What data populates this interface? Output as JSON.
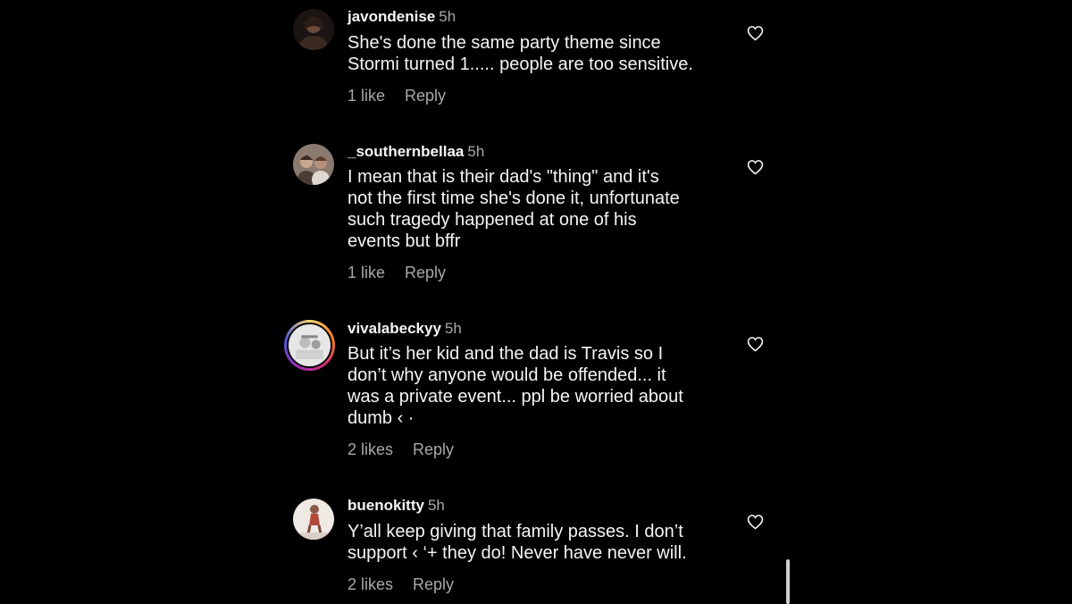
{
  "comments": [
    {
      "username": "javondenise",
      "time": "5h",
      "text": "She's done the same party theme since\nStormi turned 1..... people are too sensitive.",
      "likes": "1 like",
      "reply": "Reply",
      "avatar_color": "#4a3a32"
    },
    {
      "username": "_southernbellaa",
      "time": "5h",
      "text": "I mean that is their dad's \"thing\" and it's\nnot the first time she's done it, unfortunate\nsuch tragedy happened at one of his\nevents but bffr",
      "likes": "1 like",
      "reply": "Reply",
      "avatar_color": "#7a6a60"
    },
    {
      "username": "vivalabeckyy",
      "time": "5h",
      "text": "But it’s her kid and the dad is Travis so I\ndon’t why anyone would be offended... it\nwas a private event... ppl be worried about\ndumb ‹  ·",
      "likes": "2 likes",
      "reply": "Reply",
      "avatar_color": "#d9d9d9",
      "has_story_ring": true
    },
    {
      "username": "buenokitty",
      "time": "5h",
      "text": "Y’all keep giving that family passes. I don’t\nsupport ‹  ‘+ they do! Never have never will.",
      "likes": "2 likes",
      "reply": "Reply",
      "avatar_color": "#e8e2dc"
    }
  ],
  "colors": {
    "background": "#000000",
    "primary_text": "#f5f5f5",
    "secondary_text": "#a8a8a8"
  },
  "icons": {
    "like": "heart-outline-icon"
  }
}
